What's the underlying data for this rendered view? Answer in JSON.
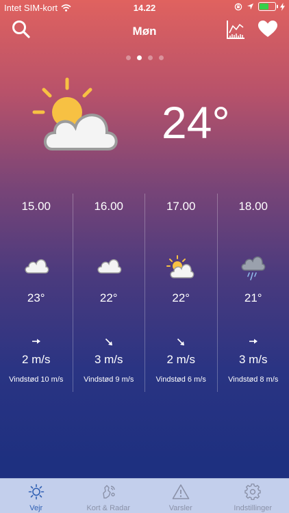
{
  "status": {
    "carrier": "Intet SIM-kort",
    "time": "14.22"
  },
  "header": {
    "title": "Møn"
  },
  "pager": {
    "count": 4,
    "active": 1
  },
  "current": {
    "temperature": "24°",
    "icon": "partly-cloudy-sun-icon"
  },
  "hourly": [
    {
      "hour": "15.00",
      "icon": "cloud-icon",
      "temp": "23°",
      "wind_dir": "east",
      "wind": "2 m/s",
      "gust": "Vindstød 10 m/s"
    },
    {
      "hour": "16.00",
      "icon": "cloud-icon",
      "temp": "22°",
      "wind_dir": "south-east",
      "wind": "3 m/s",
      "gust": "Vindstød 9 m/s"
    },
    {
      "hour": "17.00",
      "icon": "partly-cloudy-sun-icon",
      "temp": "22°",
      "wind_dir": "south-east",
      "wind": "2 m/s",
      "gust": "Vindstød 6 m/s"
    },
    {
      "hour": "18.00",
      "icon": "rain-cloud-icon",
      "temp": "21°",
      "wind_dir": "east",
      "wind": "3 m/s",
      "gust": "Vindstød 8 m/s"
    }
  ],
  "tabs": [
    {
      "label": "Vejr",
      "icon": "sun-icon",
      "active": true
    },
    {
      "label": "Kort & Radar",
      "icon": "map-radar-icon",
      "active": false
    },
    {
      "label": "Varsler",
      "icon": "warning-icon",
      "active": false
    },
    {
      "label": "Indstillinger",
      "icon": "gear-icon",
      "active": false
    }
  ],
  "colors": {
    "accent": "#2f5fb3",
    "tab_inactive": "#8a91a8",
    "tabbar_bg": "#c3cfec",
    "sun": "#f7c143",
    "battery": "#36d04a"
  }
}
